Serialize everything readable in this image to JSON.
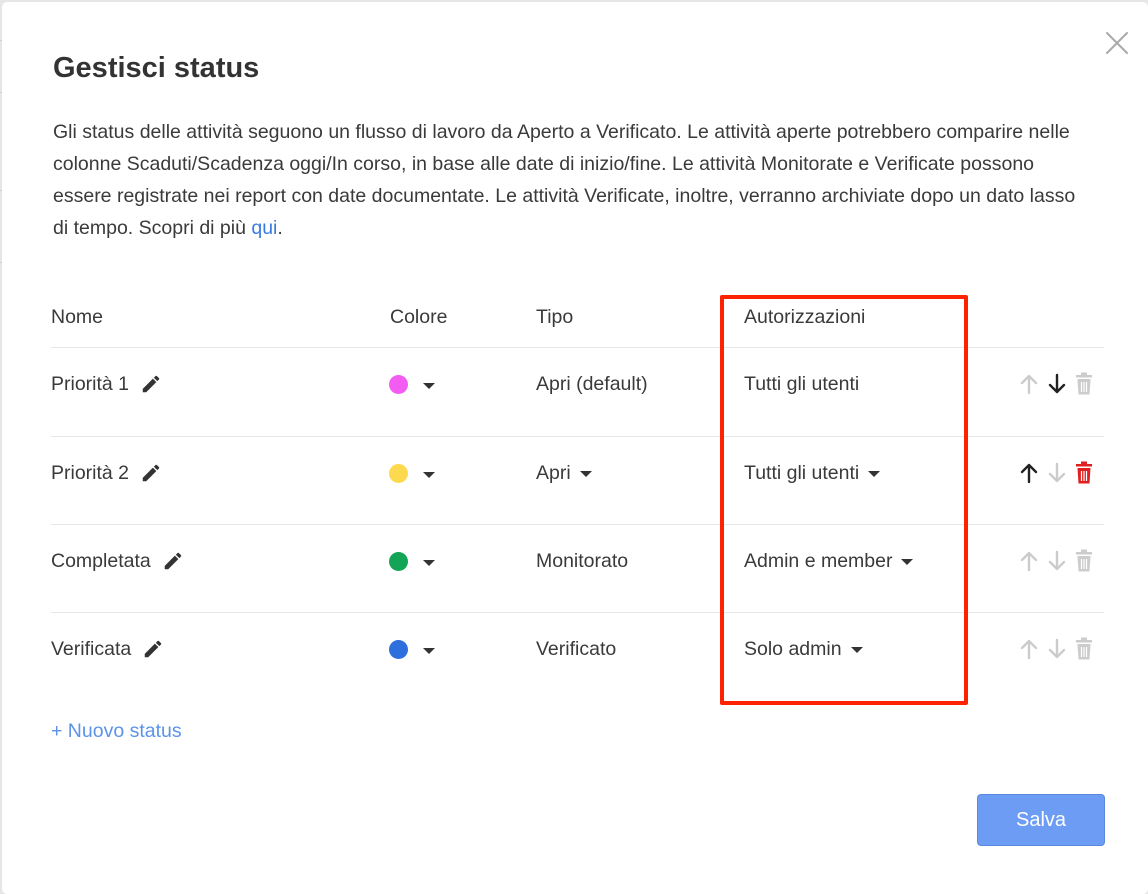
{
  "dialog": {
    "title": "Gestisci status",
    "intro_text": "Gli status delle attività seguono un flusso di lavoro da Aperto a Verificato. Le attività aperte potrebbero comparire nelle colonne Scaduti/Scadenza oggi/In corso, in base alle date di inizio/fine. Le attività Monitorate e Verificate possono essere registrate nei report con date documentate. Le attività Verificate, inoltre, verranno archiviate dopo un dato lasso di tempo. Scopri di più ",
    "intro_link": "qui",
    "intro_end": "."
  },
  "table": {
    "headers": {
      "name": "Nome",
      "color": "Colore",
      "type": "Tipo",
      "permissions": "Autorizzazioni"
    },
    "rows": [
      {
        "name": "Priorità 1",
        "color": "#f25cf0",
        "type": "Apri (default)",
        "type_dropdown": false,
        "permission": "Tutti gli utenti",
        "permission_dropdown": false,
        "up_enabled": false,
        "down_enabled": true,
        "delete_enabled": false
      },
      {
        "name": "Priorità 2",
        "color": "#fdd94e",
        "type": "Apri",
        "type_dropdown": true,
        "permission": "Tutti gli utenti",
        "permission_dropdown": true,
        "up_enabled": true,
        "down_enabled": false,
        "delete_enabled": true
      },
      {
        "name": "Completata",
        "color": "#13a456",
        "type": "Monitorato",
        "type_dropdown": false,
        "permission": "Admin e member",
        "permission_dropdown": true,
        "up_enabled": false,
        "down_enabled": false,
        "delete_enabled": false
      },
      {
        "name": "Verificata",
        "color": "#2c6fdd",
        "type": "Verificato",
        "type_dropdown": false,
        "permission": "Solo admin",
        "permission_dropdown": true,
        "up_enabled": false,
        "down_enabled": false,
        "delete_enabled": false
      }
    ]
  },
  "new_status_label": "+ Nuovo status",
  "save_label": "Salva",
  "colors": {
    "link": "#3a7be0",
    "save_button": "#6d9cf5",
    "delete_active": "#e02020",
    "icon_active": "#222222",
    "icon_disabled": "#cccccc",
    "highlight_box": "#ff2200"
  },
  "icons": {
    "close": "close-icon",
    "edit": "pencil-icon",
    "move_up": "arrow-up-icon",
    "move_down": "arrow-down-icon",
    "delete": "trash-icon"
  }
}
